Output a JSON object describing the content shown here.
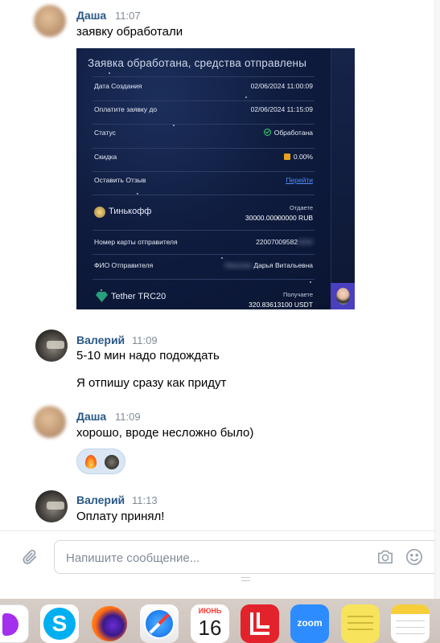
{
  "messages": [
    {
      "author": "Даша",
      "time": "11:07",
      "texts": [
        "заявку обработали"
      ]
    },
    {
      "author": "Валерий",
      "time": "11:09",
      "texts": [
        "5-10 мин надо подождать",
        "Я отпишу сразу как придут"
      ]
    },
    {
      "author": "Даша",
      "time": "11:09",
      "texts": [
        "хорошо, вроде несложно было)"
      ]
    },
    {
      "author": "Валерий",
      "time": "11:13",
      "texts": [
        "Оплату принял!"
      ]
    }
  ],
  "receipt": {
    "title": "Заявка обработана, средства отправлены",
    "rows": [
      {
        "label": "Дата Создания",
        "value": "02/06/2024 11:00:09"
      },
      {
        "label": "Оплатите заявку до",
        "value": "02/06/2024 11:15:09"
      },
      {
        "label": "Статус",
        "value": "Обработана",
        "icon": "check-circle-icon"
      },
      {
        "label": "Скидка",
        "value": "0.00%",
        "icon": "gift-icon"
      },
      {
        "label": "Оставить Отзыв",
        "value": "Перейти"
      }
    ],
    "send_bank": "Тинькофф",
    "send_label": "Отдаете",
    "send_amount": "30000.00000000 RUB",
    "card_label": "Номер карты отправителя",
    "card_value": "22007009582",
    "name_label": "ФИО Отправителя",
    "name_value": "Дарья Витальевна",
    "receive_currency": "Tether TRC20",
    "receive_label": "Получаете",
    "receive_amount": "320.83613100 USDT"
  },
  "reactions": {
    "emoji": "fire-icon"
  },
  "composer": {
    "placeholder": "Напишите сообщение...",
    "attach_icon": "paperclip-icon",
    "camera_icon": "camera-icon",
    "emoji_icon": "smile-icon"
  },
  "dock": {
    "calendar_month": "ИЮНЬ",
    "calendar_day": "16",
    "zoom_label": "zoom",
    "skype_letter": "S",
    "apps": [
      "d-app-icon",
      "skype-icon",
      "firefox-icon",
      "safari-icon",
      "calendar-icon",
      "lastpass-icon",
      "zoom-icon",
      "stickies-icon",
      "notes-icon"
    ]
  },
  "colors": {
    "author": "#2a5885",
    "time": "#818c99",
    "link": "#4e8cff",
    "reaction_bg": "#dae6f4"
  }
}
